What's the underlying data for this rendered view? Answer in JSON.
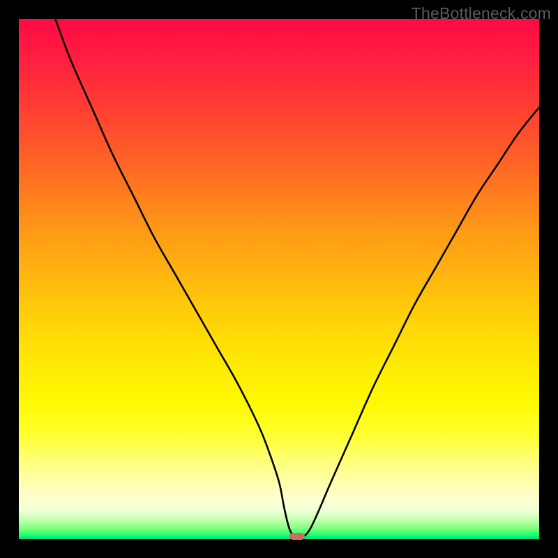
{
  "watermark": "TheBottleneck.com",
  "colors": {
    "curve_stroke": "#000000",
    "marker_fill": "#cd6a62",
    "frame": "#000000"
  },
  "chart_data": {
    "type": "line",
    "title": "",
    "xlabel": "",
    "ylabel": "",
    "xlim": [
      0,
      100
    ],
    "ylim": [
      0,
      100
    ],
    "grid": false,
    "legend": false,
    "series": [
      {
        "name": "bottleneck-curve",
        "x": [
          7,
          10,
          14,
          18,
          22,
          26,
          30,
          34,
          38,
          42,
          46,
          48,
          50,
          51,
          52,
          53,
          54,
          56,
          60,
          64,
          68,
          72,
          76,
          80,
          84,
          88,
          92,
          96,
          100
        ],
        "y": [
          100,
          92,
          83,
          74,
          66,
          58,
          51,
          44,
          37,
          30,
          22,
          17,
          11,
          6,
          2,
          0.5,
          0.5,
          2,
          11,
          20,
          29,
          37,
          45,
          52,
          59,
          66,
          72,
          78,
          83
        ]
      }
    ],
    "marker": {
      "x": 53.5,
      "y": 0.5
    }
  }
}
